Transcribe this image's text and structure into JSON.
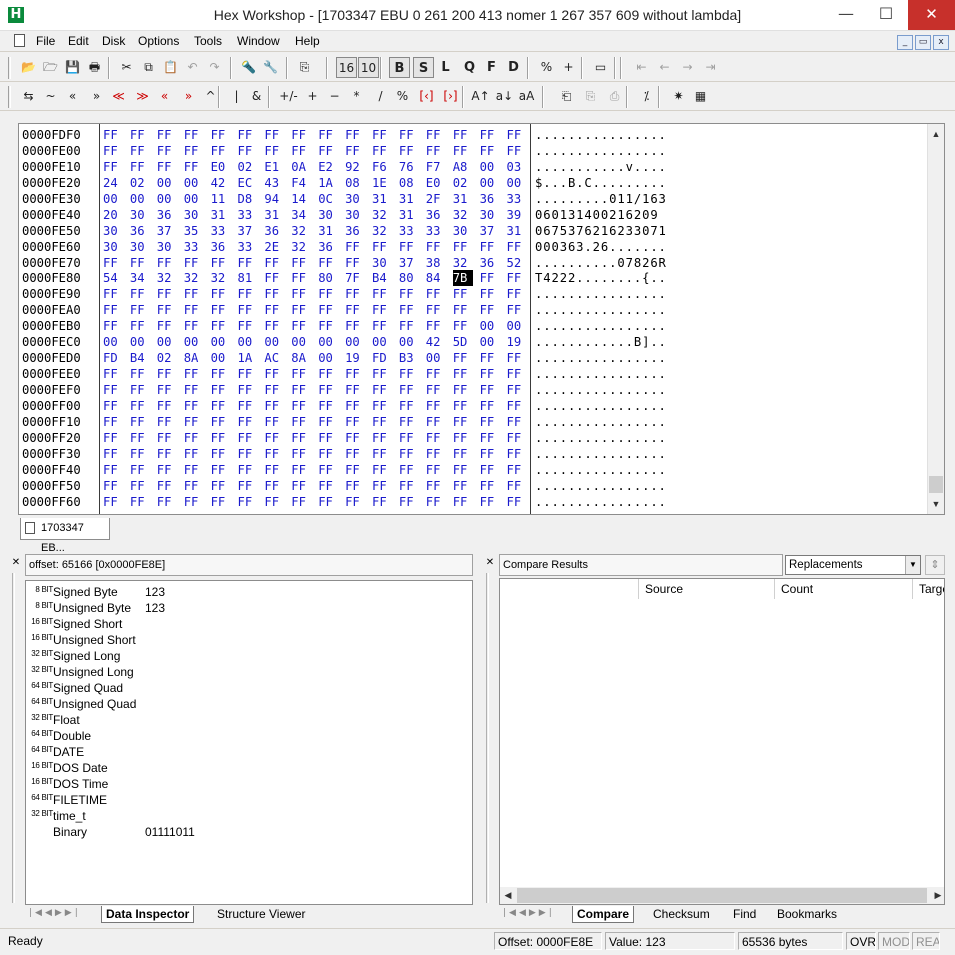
{
  "window": {
    "title": "Hex Workshop - [1703347 EBU 0 261 200 413 nomer  1 267 357 609 without lambda]",
    "icon_letter": "H",
    "min_glyph": "—",
    "max_glyph": "☐",
    "close_glyph": "✕"
  },
  "menu": {
    "items": [
      "File",
      "Edit",
      "Disk",
      "Options",
      "Tools",
      "Window",
      "Help"
    ],
    "mdi": [
      "_",
      "▭",
      "x"
    ]
  },
  "toolbar1": [
    {
      "name": "open-icon",
      "glyph": "📂"
    },
    {
      "name": "open-folder-icon",
      "glyph": "🗁"
    },
    {
      "name": "save-icon",
      "glyph": "💾"
    },
    {
      "name": "print-icon",
      "glyph": "🖶"
    },
    {
      "name": "cut-icon",
      "glyph": "✂"
    },
    {
      "name": "copy-icon",
      "glyph": "⧉"
    },
    {
      "name": "paste-icon",
      "glyph": "📋"
    },
    {
      "name": "undo-icon",
      "glyph": "↶"
    },
    {
      "name": "redo-icon",
      "glyph": "↷"
    },
    {
      "name": "find-icon",
      "glyph": "🔦"
    },
    {
      "name": "replace-icon",
      "glyph": "🔧"
    },
    {
      "name": "compare-icon",
      "glyph": "⎘"
    },
    {
      "name": "hex16-icon",
      "glyph": "16"
    },
    {
      "name": "dec10-icon",
      "glyph": "10"
    },
    {
      "name": "byte-mode",
      "glyph": "B"
    },
    {
      "name": "short-mode",
      "glyph": "S"
    },
    {
      "name": "long-mode",
      "glyph": "L"
    },
    {
      "name": "quad-mode",
      "glyph": "Q"
    },
    {
      "name": "float-mode",
      "glyph": "F"
    },
    {
      "name": "double-mode",
      "glyph": "D"
    },
    {
      "name": "percent-icon",
      "glyph": "%"
    },
    {
      "name": "plus-box-icon",
      "glyph": "+"
    },
    {
      "name": "panel-icon",
      "glyph": "▭"
    },
    {
      "name": "first-icon",
      "glyph": "⇤"
    },
    {
      "name": "back-icon",
      "glyph": "←"
    },
    {
      "name": "forward-icon",
      "glyph": "→"
    },
    {
      "name": "last-icon",
      "glyph": "⇥"
    }
  ],
  "toolbar2": [
    {
      "name": "swap-icon",
      "glyph": "⇆"
    },
    {
      "name": "not-icon",
      "glyph": "~"
    },
    {
      "name": "shift-left-icon",
      "glyph": "«"
    },
    {
      "name": "shift-right-icon",
      "glyph": "»"
    },
    {
      "name": "rotate-left-icon",
      "glyph": "≪"
    },
    {
      "name": "rotate-right-icon",
      "glyph": "≫"
    },
    {
      "name": "shift-left-red-icon",
      "glyph": "«"
    },
    {
      "name": "shift-right-red-icon",
      "glyph": "»"
    },
    {
      "name": "xor-icon",
      "glyph": "^"
    },
    {
      "name": "or-icon",
      "glyph": "|"
    },
    {
      "name": "and-icon",
      "glyph": "&"
    },
    {
      "name": "negate-icon",
      "glyph": "+/-"
    },
    {
      "name": "add-icon",
      "glyph": "+"
    },
    {
      "name": "subtract-icon",
      "glyph": "−"
    },
    {
      "name": "multiply-icon",
      "glyph": "*"
    },
    {
      "name": "divide-icon",
      "glyph": "/"
    },
    {
      "name": "mod-icon",
      "glyph": "%"
    },
    {
      "name": "bracket-left-icon",
      "glyph": "[‹]"
    },
    {
      "name": "bracket-right-icon",
      "glyph": "[›]"
    },
    {
      "name": "upper-icon",
      "glyph": "A↑"
    },
    {
      "name": "lower-icon",
      "glyph": "a↓"
    },
    {
      "name": "case-icon",
      "glyph": "aA"
    },
    {
      "name": "clip-a-icon",
      "glyph": "⎗"
    },
    {
      "name": "clip-b-icon",
      "glyph": "⎘"
    },
    {
      "name": "clip-c-icon",
      "glyph": "⎙"
    },
    {
      "name": "percent-slash-icon",
      "glyph": "⁒"
    },
    {
      "name": "chip-icon",
      "glyph": "✷"
    },
    {
      "name": "calculator-icon",
      "glyph": "▦"
    }
  ],
  "hex": {
    "selected": {
      "row": 9,
      "col": 14
    },
    "rows": [
      {
        "addr": "0000FDF0",
        "bytes": [
          "FF",
          "FF",
          "FF",
          "FF",
          "FF",
          "FF",
          "FF",
          "FF",
          "FF",
          "FF",
          "FF",
          "FF",
          "FF",
          "FF",
          "FF",
          "FF"
        ],
        "ascii": "................"
      },
      {
        "addr": "0000FE00",
        "bytes": [
          "FF",
          "FF",
          "FF",
          "FF",
          "FF",
          "FF",
          "FF",
          "FF",
          "FF",
          "FF",
          "FF",
          "FF",
          "FF",
          "FF",
          "FF",
          "FF"
        ],
        "ascii": "................"
      },
      {
        "addr": "0000FE10",
        "bytes": [
          "FF",
          "FF",
          "FF",
          "FF",
          "E0",
          "02",
          "E1",
          "0A",
          "E2",
          "92",
          "F6",
          "76",
          "F7",
          "A8",
          "00",
          "03"
        ],
        "ascii": "...........v...."
      },
      {
        "addr": "0000FE20",
        "bytes": [
          "24",
          "02",
          "00",
          "00",
          "42",
          "EC",
          "43",
          "F4",
          "1A",
          "08",
          "1E",
          "08",
          "E0",
          "02",
          "00",
          "00"
        ],
        "ascii": "$...B.C........."
      },
      {
        "addr": "0000FE30",
        "bytes": [
          "00",
          "00",
          "00",
          "00",
          "11",
          "D8",
          "94",
          "14",
          "0C",
          "30",
          "31",
          "31",
          "2F",
          "31",
          "36",
          "33"
        ],
        "ascii": ".........011/163"
      },
      {
        "addr": "0000FE40",
        "bytes": [
          "20",
          "30",
          "36",
          "30",
          "31",
          "33",
          "31",
          "34",
          "30",
          "30",
          "32",
          "31",
          "36",
          "32",
          "30",
          "39"
        ],
        "ascii": " 060131400216209"
      },
      {
        "addr": "0000FE50",
        "bytes": [
          "30",
          "36",
          "37",
          "35",
          "33",
          "37",
          "36",
          "32",
          "31",
          "36",
          "32",
          "33",
          "33",
          "30",
          "37",
          "31"
        ],
        "ascii": "0675376216233071"
      },
      {
        "addr": "0000FE60",
        "bytes": [
          "30",
          "30",
          "30",
          "33",
          "36",
          "33",
          "2E",
          "32",
          "36",
          "FF",
          "FF",
          "FF",
          "FF",
          "FF",
          "FF",
          "FF"
        ],
        "ascii": "000363.26......."
      },
      {
        "addr": "0000FE70",
        "bytes": [
          "FF",
          "FF",
          "FF",
          "FF",
          "FF",
          "FF",
          "FF",
          "FF",
          "FF",
          "FF",
          "30",
          "37",
          "38",
          "32",
          "36",
          "52"
        ],
        "ascii": "..........07826R"
      },
      {
        "addr": "0000FE80",
        "bytes": [
          "54",
          "34",
          "32",
          "32",
          "32",
          "81",
          "FF",
          "FF",
          "80",
          "7F",
          "B4",
          "80",
          "84",
          "7B",
          "FF",
          "FF"
        ],
        "ascii": "T4222........{.."
      },
      {
        "addr": "0000FE90",
        "bytes": [
          "FF",
          "FF",
          "FF",
          "FF",
          "FF",
          "FF",
          "FF",
          "FF",
          "FF",
          "FF",
          "FF",
          "FF",
          "FF",
          "FF",
          "FF",
          "FF"
        ],
        "ascii": "................"
      },
      {
        "addr": "0000FEA0",
        "bytes": [
          "FF",
          "FF",
          "FF",
          "FF",
          "FF",
          "FF",
          "FF",
          "FF",
          "FF",
          "FF",
          "FF",
          "FF",
          "FF",
          "FF",
          "FF",
          "FF"
        ],
        "ascii": "................"
      },
      {
        "addr": "0000FEB0",
        "bytes": [
          "FF",
          "FF",
          "FF",
          "FF",
          "FF",
          "FF",
          "FF",
          "FF",
          "FF",
          "FF",
          "FF",
          "FF",
          "FF",
          "FF",
          "00",
          "00"
        ],
        "ascii": "................"
      },
      {
        "addr": "0000FEC0",
        "bytes": [
          "00",
          "00",
          "00",
          "00",
          "00",
          "00",
          "00",
          "00",
          "00",
          "00",
          "00",
          "00",
          "42",
          "5D",
          "00",
          "19"
        ],
        "ascii": "............B].."
      },
      {
        "addr": "0000FED0",
        "bytes": [
          "FD",
          "B4",
          "02",
          "8A",
          "00",
          "1A",
          "AC",
          "8A",
          "00",
          "19",
          "FD",
          "B3",
          "00",
          "FF",
          "FF",
          "FF"
        ],
        "ascii": "................"
      },
      {
        "addr": "0000FEE0",
        "bytes": [
          "FF",
          "FF",
          "FF",
          "FF",
          "FF",
          "FF",
          "FF",
          "FF",
          "FF",
          "FF",
          "FF",
          "FF",
          "FF",
          "FF",
          "FF",
          "FF"
        ],
        "ascii": "................"
      },
      {
        "addr": "0000FEF0",
        "bytes": [
          "FF",
          "FF",
          "FF",
          "FF",
          "FF",
          "FF",
          "FF",
          "FF",
          "FF",
          "FF",
          "FF",
          "FF",
          "FF",
          "FF",
          "FF",
          "FF"
        ],
        "ascii": "................"
      },
      {
        "addr": "0000FF00",
        "bytes": [
          "FF",
          "FF",
          "FF",
          "FF",
          "FF",
          "FF",
          "FF",
          "FF",
          "FF",
          "FF",
          "FF",
          "FF",
          "FF",
          "FF",
          "FF",
          "FF"
        ],
        "ascii": "................"
      },
      {
        "addr": "0000FF10",
        "bytes": [
          "FF",
          "FF",
          "FF",
          "FF",
          "FF",
          "FF",
          "FF",
          "FF",
          "FF",
          "FF",
          "FF",
          "FF",
          "FF",
          "FF",
          "FF",
          "FF"
        ],
        "ascii": "................"
      },
      {
        "addr": "0000FF20",
        "bytes": [
          "FF",
          "FF",
          "FF",
          "FF",
          "FF",
          "FF",
          "FF",
          "FF",
          "FF",
          "FF",
          "FF",
          "FF",
          "FF",
          "FF",
          "FF",
          "FF"
        ],
        "ascii": "................"
      },
      {
        "addr": "0000FF30",
        "bytes": [
          "FF",
          "FF",
          "FF",
          "FF",
          "FF",
          "FF",
          "FF",
          "FF",
          "FF",
          "FF",
          "FF",
          "FF",
          "FF",
          "FF",
          "FF",
          "FF"
        ],
        "ascii": "................"
      },
      {
        "addr": "0000FF40",
        "bytes": [
          "FF",
          "FF",
          "FF",
          "FF",
          "FF",
          "FF",
          "FF",
          "FF",
          "FF",
          "FF",
          "FF",
          "FF",
          "FF",
          "FF",
          "FF",
          "FF"
        ],
        "ascii": "................"
      },
      {
        "addr": "0000FF50",
        "bytes": [
          "FF",
          "FF",
          "FF",
          "FF",
          "FF",
          "FF",
          "FF",
          "FF",
          "FF",
          "FF",
          "FF",
          "FF",
          "FF",
          "FF",
          "FF",
          "FF"
        ],
        "ascii": "................"
      },
      {
        "addr": "0000FF60",
        "bytes": [
          "FF",
          "FF",
          "FF",
          "FF",
          "FF",
          "FF",
          "FF",
          "FF",
          "FF",
          "FF",
          "FF",
          "FF",
          "FF",
          "FF",
          "FF",
          "FF"
        ],
        "ascii": "................"
      }
    ],
    "scroll_up": "▲",
    "scroll_down": "▼"
  },
  "doc_tab": {
    "label": "1703347 EB..."
  },
  "data_inspector": {
    "header": "offset: 65166 [0x0000FE8E]",
    "rows": [
      {
        "bits": "8 BIT",
        "label": "Signed Byte",
        "value": "123"
      },
      {
        "bits": "8 BIT",
        "label": "Unsigned Byte",
        "value": "123"
      },
      {
        "bits": "16 BIT",
        "label": "Signed Short",
        "value": ""
      },
      {
        "bits": "16 BIT",
        "label": "Unsigned Short",
        "value": ""
      },
      {
        "bits": "32 BIT",
        "label": "Signed Long",
        "value": ""
      },
      {
        "bits": "32 BIT",
        "label": "Unsigned Long",
        "value": ""
      },
      {
        "bits": "64 BIT",
        "label": "Signed Quad",
        "value": ""
      },
      {
        "bits": "64 BIT",
        "label": "Unsigned Quad",
        "value": ""
      },
      {
        "bits": "32 BIT",
        "label": "Float",
        "value": ""
      },
      {
        "bits": "64 BIT",
        "label": "Double",
        "value": ""
      },
      {
        "bits": "64 BIT",
        "label": "DATE",
        "value": ""
      },
      {
        "bits": "16 BIT",
        "label": "DOS Date",
        "value": ""
      },
      {
        "bits": "16 BIT",
        "label": "DOS Time",
        "value": ""
      },
      {
        "bits": "64 BIT",
        "label": "FILETIME",
        "value": ""
      },
      {
        "bits": "32 BIT",
        "label": "time_t",
        "value": ""
      },
      {
        "bits": "",
        "label": "Binary",
        "value": "01111011"
      }
    ],
    "tabs": [
      "Data Inspector",
      "Structure Viewer"
    ],
    "tab_nav": "|◀◀▶▶|",
    "close_glyph": "✕"
  },
  "compare": {
    "header": "Compare Results",
    "select_value": "Replacements",
    "select_arrow": "▼",
    "pin_glyph": "⇕",
    "columns": [
      "",
      "Source",
      "Count",
      "Target"
    ],
    "tabs": [
      "Compare",
      "Checksum",
      "Find",
      "Bookmarks"
    ],
    "tab_nav": "|◀◀▶▶|",
    "scroll_left": "◀",
    "scroll_right": "▶",
    "close_glyph": "✕"
  },
  "status": {
    "ready": "Ready",
    "offset": "Offset: 0000FE8E",
    "value": "Value: 123",
    "size": "65536 bytes",
    "ovr": "OVR",
    "mod": "MOD",
    "rea": "REA"
  }
}
